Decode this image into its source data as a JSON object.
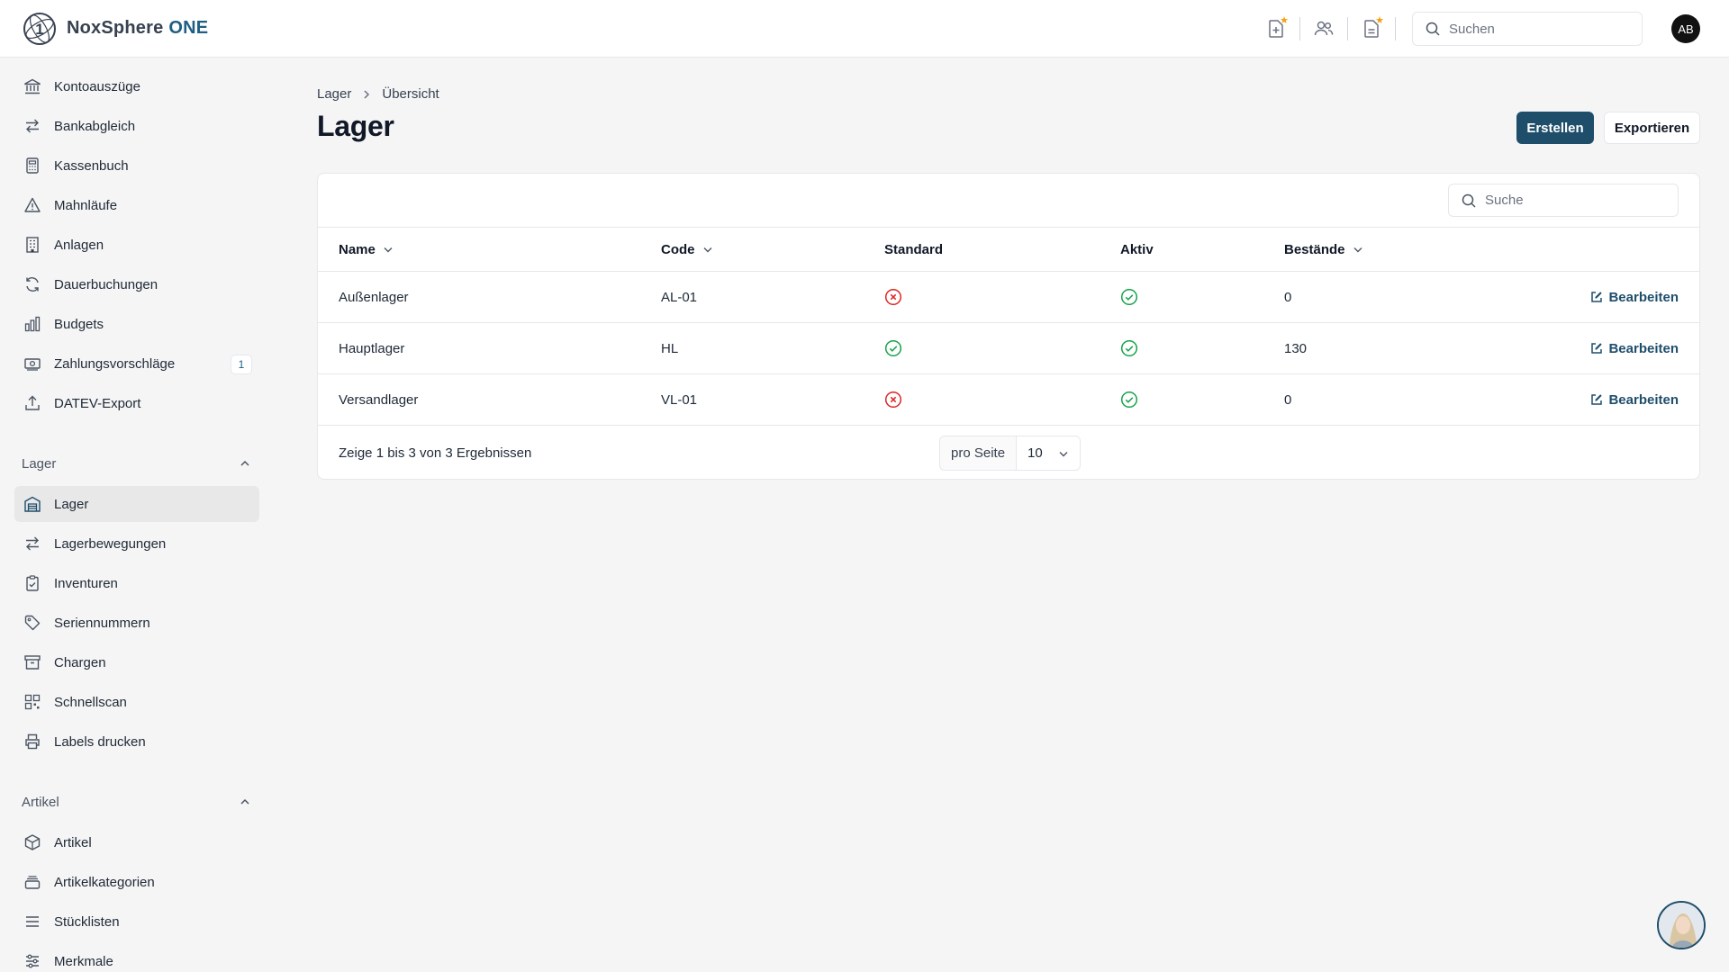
{
  "app": {
    "brand_name": "NoxSphere",
    "brand_suffix": "ONE",
    "brand_logo_text": "1",
    "user_initials": "AB"
  },
  "topbar": {
    "search_placeholder": "Suchen",
    "icons": [
      "file-plus-icon",
      "users-icon",
      "document-icon"
    ]
  },
  "sidebar": {
    "items_top": [
      {
        "label": "Kontoauszüge",
        "icon": "bank-icon"
      },
      {
        "label": "Bankabgleich",
        "icon": "arrows-exchange-icon"
      },
      {
        "label": "Kassenbuch",
        "icon": "calculator-icon"
      },
      {
        "label": "Mahnläufe",
        "icon": "warning-icon"
      },
      {
        "label": "Anlagen",
        "icon": "building-icon"
      },
      {
        "label": "Dauerbuchungen",
        "icon": "refresh-icon"
      },
      {
        "label": "Budgets",
        "icon": "bar-chart-icon"
      },
      {
        "label": "Zahlungsvorschläge",
        "icon": "money-icon",
        "badge": "1"
      },
      {
        "label": "DATEV-Export",
        "icon": "upload-icon"
      }
    ],
    "section_lager": "Lager",
    "items_lager": [
      {
        "label": "Lager",
        "icon": "warehouse-icon",
        "active": true
      },
      {
        "label": "Lagerbewegungen",
        "icon": "arrows-exchange-icon"
      },
      {
        "label": "Inventuren",
        "icon": "clipboard-check-icon"
      },
      {
        "label": "Seriennummern",
        "icon": "tag-icon"
      },
      {
        "label": "Chargen",
        "icon": "archive-icon"
      },
      {
        "label": "Schnellscan",
        "icon": "qr-code-icon"
      },
      {
        "label": "Labels drucken",
        "icon": "printer-icon"
      }
    ],
    "section_artikel": "Artikel",
    "items_artikel": [
      {
        "label": "Artikel",
        "icon": "cube-icon"
      },
      {
        "label": "Artikelkategorien",
        "icon": "stack-icon"
      },
      {
        "label": "Stücklisten",
        "icon": "list-icon"
      },
      {
        "label": "Merkmale",
        "icon": "sliders-icon"
      }
    ]
  },
  "main": {
    "breadcrumb": [
      "Lager",
      "Übersicht"
    ],
    "title": "Lager",
    "create_label": "Erstellen",
    "export_label": "Exportieren",
    "table_search_placeholder": "Suche",
    "columns": {
      "name": "Name",
      "code": "Code",
      "standard": "Standard",
      "aktiv": "Aktiv",
      "bestaende": "Bestände"
    },
    "edit_label": "Bearbeiten",
    "rows": [
      {
        "name": "Außenlager",
        "code": "AL-01",
        "standard": false,
        "aktiv": true,
        "bestaende": "0"
      },
      {
        "name": "Hauptlager",
        "code": "HL",
        "standard": true,
        "aktiv": true,
        "bestaende": "130"
      },
      {
        "name": "Versandlager",
        "code": "VL-01",
        "standard": false,
        "aktiv": true,
        "bestaende": "0"
      }
    ],
    "result_text": "Zeige 1 bis 3 von 3 Ergebnissen",
    "per_page_label": "pro Seite",
    "per_page_value": "10"
  },
  "colors": {
    "accent": "#1f4e6b",
    "success": "#16a34a",
    "danger": "#dc2626",
    "star": "#f59e0b"
  }
}
